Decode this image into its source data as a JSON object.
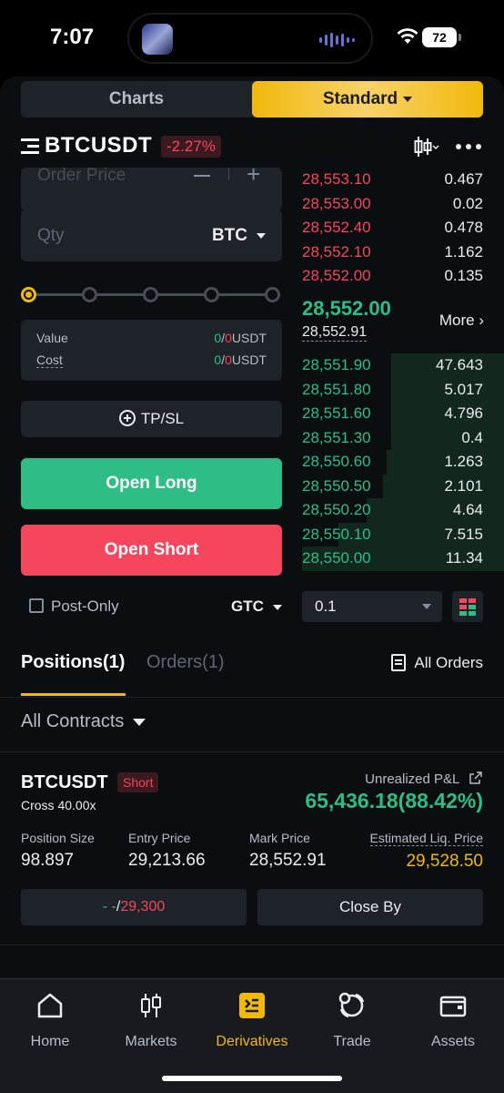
{
  "status_bar": {
    "time": "7:07",
    "battery": "72"
  },
  "header": {
    "toggle": {
      "charts": "Charts",
      "standard": "Standard"
    },
    "symbol": "BTCUSDT",
    "change": "-2.27%"
  },
  "order_form": {
    "order_price_placeholder": "Order Price",
    "qty_placeholder": "Qty",
    "qty_unit": "BTC",
    "slider_percent": 0,
    "value_label": "Value",
    "value_long": "0",
    "value_short": "0",
    "value_unit": "USDT",
    "cost_label": "Cost",
    "cost_long": "0",
    "cost_short": "0",
    "cost_unit": "USDT",
    "tpsl": "TP/SL",
    "open_long": "Open Long",
    "open_short": "Open Short",
    "post_only": "Post-Only",
    "time_in_force": "GTC"
  },
  "order_book": {
    "asks": [
      {
        "price": "28,553.10",
        "qty": "0.467"
      },
      {
        "price": "28,553.00",
        "qty": "0.02"
      },
      {
        "price": "28,552.40",
        "qty": "0.478"
      },
      {
        "price": "28,552.10",
        "qty": "1.162"
      },
      {
        "price": "28,552.00",
        "qty": "0.135"
      }
    ],
    "last_price": "28,552.00",
    "mark_price": "28,552.91",
    "more": "More",
    "bids": [
      {
        "price": "28,551.90",
        "qty": "47.643",
        "depth": 0.56
      },
      {
        "price": "28,551.80",
        "qty": "5.017",
        "depth": 0.56
      },
      {
        "price": "28,551.60",
        "qty": "4.796",
        "depth": 0.56
      },
      {
        "price": "28,551.30",
        "qty": "0.4",
        "depth": 0.56
      },
      {
        "price": "28,550.60",
        "qty": "1.263",
        "depth": 0.58
      },
      {
        "price": "28,550.50",
        "qty": "2.101",
        "depth": 0.6
      },
      {
        "price": "28,550.20",
        "qty": "4.64",
        "depth": 0.68
      },
      {
        "price": "28,550.10",
        "qty": "7.515",
        "depth": 0.82
      },
      {
        "price": "28,550.00",
        "qty": "11.34",
        "depth": 1.0
      }
    ],
    "aggregation": "0.1"
  },
  "positions": {
    "tab_positions": "Positions(1)",
    "tab_orders": "Orders(1)",
    "all_orders": "All Orders",
    "filter": "All Contracts",
    "item": {
      "symbol": "BTCUSDT",
      "side": "Short",
      "margin": "Cross 40.00x",
      "pnl_label": "Unrealized P&L",
      "pnl_value": "65,436.18(88.42%)",
      "size_label": "Position Size",
      "size": "98.897",
      "entry_label": "Entry Price",
      "entry": "29,213.66",
      "mark_label": "Mark Price",
      "mark": "28,552.91",
      "liq_label": "Estimated Liq. Price",
      "liq": "29,528.50",
      "tp": "- -",
      "sl": "29,300",
      "close_by": "Close By"
    }
  },
  "tabbar": [
    {
      "label": "Home",
      "icon": "home-icon"
    },
    {
      "label": "Markets",
      "icon": "markets-icon"
    },
    {
      "label": "Derivatives",
      "icon": "derivatives-icon",
      "active": true
    },
    {
      "label": "Trade",
      "icon": "trade-icon"
    },
    {
      "label": "Assets",
      "icon": "assets-icon"
    }
  ],
  "colors": {
    "accent": "#f0b90b",
    "buy": "#2ebd85",
    "sell": "#f6465d",
    "background": "#0b0e11",
    "panel": "#1e2329"
  }
}
